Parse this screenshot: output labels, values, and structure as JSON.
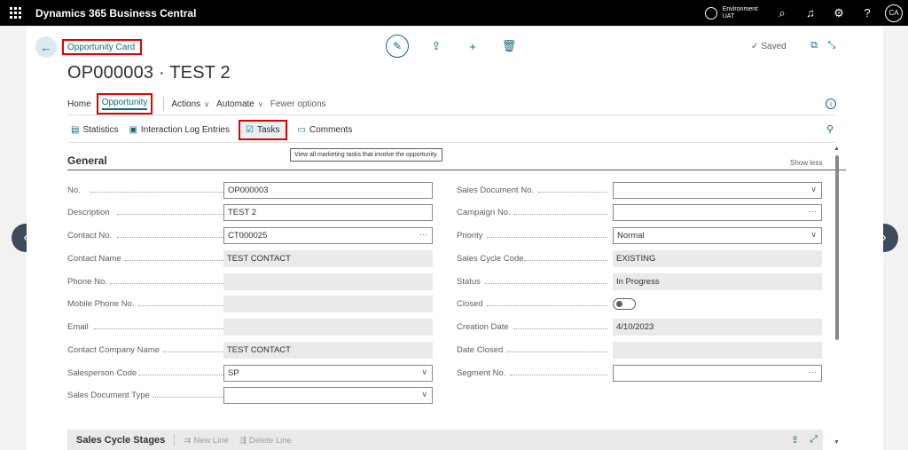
{
  "topbar": {
    "app_title": "Dynamics 365 Business Central",
    "env_label": "Environment:",
    "env_value": "UAT",
    "avatar_initials": "CA"
  },
  "page": {
    "breadcrumb": "Opportunity Card",
    "title": "OP000003 · TEST 2",
    "saved_label": "Saved"
  },
  "menu": {
    "home": "Home",
    "opportunity": "Opportunity",
    "actions": "Actions",
    "automate": "Automate",
    "fewer_options": "Fewer options"
  },
  "sub_actions": {
    "statistics": "Statistics",
    "interaction_log": "Interaction Log Entries",
    "tasks": "Tasks",
    "comments": "Comments"
  },
  "tooltip": "View all marketing tasks that involve the opportunity.",
  "general": {
    "title": "General",
    "show_less": "Show less",
    "left_fields": [
      {
        "label": "No.",
        "value": "OP000003"
      },
      {
        "label": "Description",
        "value": "TEST 2"
      },
      {
        "label": "Contact No.",
        "value": "CT000025"
      },
      {
        "label": "Contact Name",
        "value": "TEST CONTACT"
      },
      {
        "label": "Phone No.",
        "value": ""
      },
      {
        "label": "Mobile Phone No.",
        "value": ""
      },
      {
        "label": "Email",
        "value": ""
      },
      {
        "label": "Contact Company Name",
        "value": "TEST CONTACT"
      },
      {
        "label": "Salesperson Code",
        "value": "SP"
      },
      {
        "label": "Sales Document Type",
        "value": ""
      }
    ],
    "right_fields": [
      {
        "label": "Sales Document No.",
        "value": ""
      },
      {
        "label": "Campaign No.",
        "value": ""
      },
      {
        "label": "Priority",
        "value": "Normal"
      },
      {
        "label": "Sales Cycle Code",
        "value": "EXISTING"
      },
      {
        "label": "Status",
        "value": "In Progress"
      },
      {
        "label": "Closed",
        "value": ""
      },
      {
        "label": "Creation Date",
        "value": "4/10/2023"
      },
      {
        "label": "Date Closed",
        "value": ""
      },
      {
        "label": "Segment No.",
        "value": ""
      }
    ]
  },
  "stages": {
    "title": "Sales Cycle Stages",
    "new_line": "New Line",
    "delete_line": "Delete Line"
  },
  "colors": {
    "accent": "#0f6b7a",
    "highlight_box": "#e00000",
    "topbar": "#000000"
  }
}
